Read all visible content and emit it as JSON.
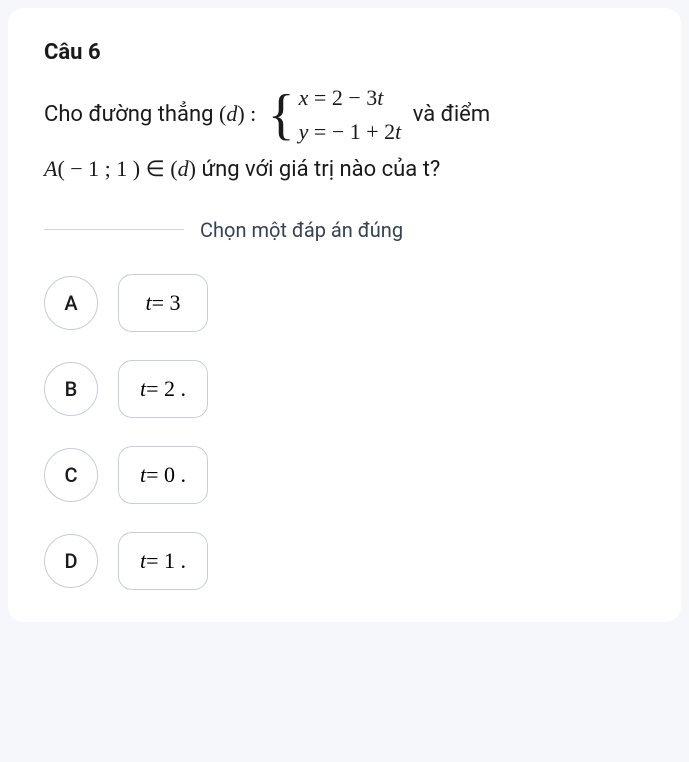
{
  "question": {
    "title": "Câu 6",
    "prefix": "Cho đường thẳng ",
    "line_label": "(",
    "line_var": "d",
    "line_label_close": ") : ",
    "eq1_lhs": "x",
    "eq1_rhs": " = 2 − 3",
    "eq1_t": "t",
    "eq2_lhs": "y",
    "eq2_rhs": " = − 1 + 2",
    "eq2_t": "t",
    "suffix": " và điểm",
    "point_A": "A",
    "point_coords": "( − 1 ; 1 ) ∈ (",
    "point_d": "d",
    "point_close": ") ",
    "tail": "ứng với giá trị nào của t?"
  },
  "instruction": "Chọn một đáp án đúng",
  "options": [
    {
      "letter": "A",
      "var": "t",
      "val": " = 3"
    },
    {
      "letter": "B",
      "var": "t",
      "val": " = 2 ."
    },
    {
      "letter": "C",
      "var": "t",
      "val": " = 0 ."
    },
    {
      "letter": "D",
      "var": "t",
      "val": " = 1 ."
    }
  ]
}
